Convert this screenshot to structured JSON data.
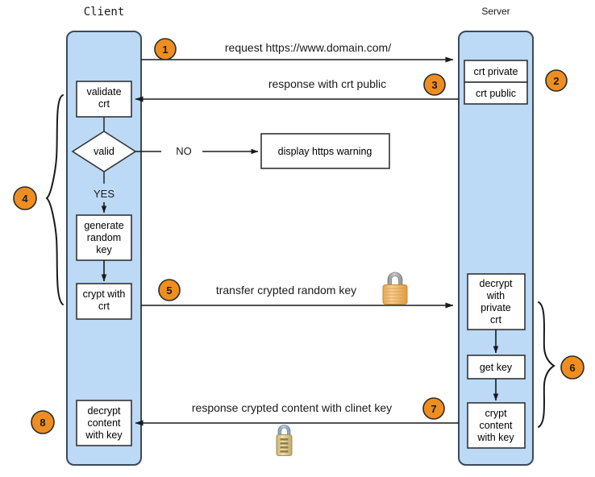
{
  "colors": {
    "lane_fill": "#bcd9f5",
    "lane_stroke": "#3b4a5a",
    "box_fill": "#ffffff",
    "box_stroke": "#333333",
    "badge_fill": "#ef8e20",
    "badge_stroke": "#2b2b2b",
    "line": "#1a1a1a",
    "background": "#ffffff",
    "padlock_body": "#f0b860",
    "padlock_shackle": "#9a9a9a",
    "padlock2_body": "#ddc98a",
    "padlock2_shackle": "#8fa3bd"
  },
  "lanes": [
    {
      "id": "client",
      "title": "Client"
    },
    {
      "id": "server",
      "title": "Server"
    }
  ],
  "client_steps": [
    {
      "id": "validate-crt",
      "lines": [
        "validate",
        "crt"
      ]
    },
    {
      "id": "valid-decision",
      "lines": [
        "valid"
      ]
    },
    {
      "id": "generate-random-key",
      "lines": [
        "generate",
        "random",
        "key"
      ]
    },
    {
      "id": "crypt-with-crt",
      "lines": [
        "crypt with",
        "crt"
      ]
    },
    {
      "id": "decrypt-content-with-key",
      "lines": [
        "decrypt",
        "content",
        "with key"
      ]
    }
  ],
  "server_steps": [
    {
      "id": "crt-private",
      "lines": [
        "crt private"
      ]
    },
    {
      "id": "crt-public",
      "lines": [
        "crt public"
      ]
    },
    {
      "id": "decrypt-with-private-crt",
      "lines": [
        "decrypt",
        "with",
        "private",
        "crt"
      ]
    },
    {
      "id": "get-key",
      "lines": [
        "get key"
      ]
    },
    {
      "id": "crypt-content-with-key",
      "lines": [
        "crypt",
        "content",
        "with key"
      ]
    }
  ],
  "external_boxes": [
    {
      "id": "display-https-warning",
      "lines": [
        "display https warning"
      ]
    }
  ],
  "branch_labels": [
    {
      "id": "branch-no",
      "text": "NO"
    },
    {
      "id": "branch-yes",
      "text": "YES"
    }
  ],
  "messages": [
    {
      "id": "msg-request",
      "text": "request https://www.domain.com/",
      "direction": "client-to-server"
    },
    {
      "id": "msg-response-crt-public",
      "text": "response with crt public",
      "direction": "server-to-client"
    },
    {
      "id": "msg-transfer-key",
      "text": "transfer crypted random key",
      "direction": "client-to-server"
    },
    {
      "id": "msg-response-content",
      "text": "response crypted content with clinet key",
      "direction": "server-to-client"
    }
  ],
  "badges": [
    {
      "id": "badge-1",
      "number": "1"
    },
    {
      "id": "badge-2",
      "number": "2"
    },
    {
      "id": "badge-3",
      "number": "3"
    },
    {
      "id": "badge-4",
      "number": "4"
    },
    {
      "id": "badge-5",
      "number": "5"
    },
    {
      "id": "badge-6",
      "number": "6"
    },
    {
      "id": "badge-7",
      "number": "7"
    },
    {
      "id": "badge-8",
      "number": "8"
    }
  ],
  "icons": [
    {
      "id": "padlock-transfer",
      "name": "padlock-closed-icon"
    },
    {
      "id": "padlock-response",
      "name": "padlock-combination-icon"
    }
  ]
}
